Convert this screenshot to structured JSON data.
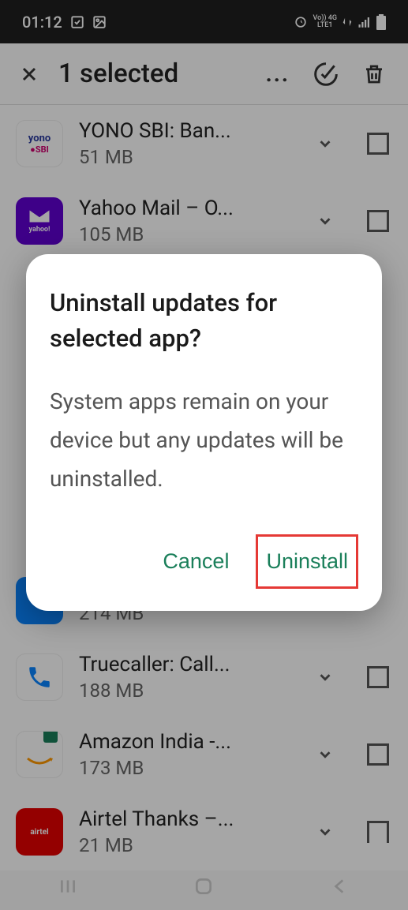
{
  "status": {
    "time": "01:12",
    "network_label": "Vo)) 4G",
    "lte_label": "LTE1"
  },
  "header": {
    "title": "1 selected"
  },
  "apps": [
    {
      "name": "YONO SBI: Ban...",
      "size": "51 MB"
    },
    {
      "name": "Yahoo Mail – O...",
      "size": "105 MB"
    },
    {
      "name_partial": "",
      "size": "214 MB"
    },
    {
      "name": "Truecaller: Call...",
      "size": "188 MB"
    },
    {
      "name": "Amazon India -...",
      "size": "173 MB"
    },
    {
      "name": "Airtel Thanks –...",
      "size": "21 MB"
    }
  ],
  "dialog": {
    "title": "Uninstall updates for selected app?",
    "body": "System apps remain on your device but any updates will be uninstalled.",
    "cancel": "Cancel",
    "confirm": "Uninstall"
  }
}
